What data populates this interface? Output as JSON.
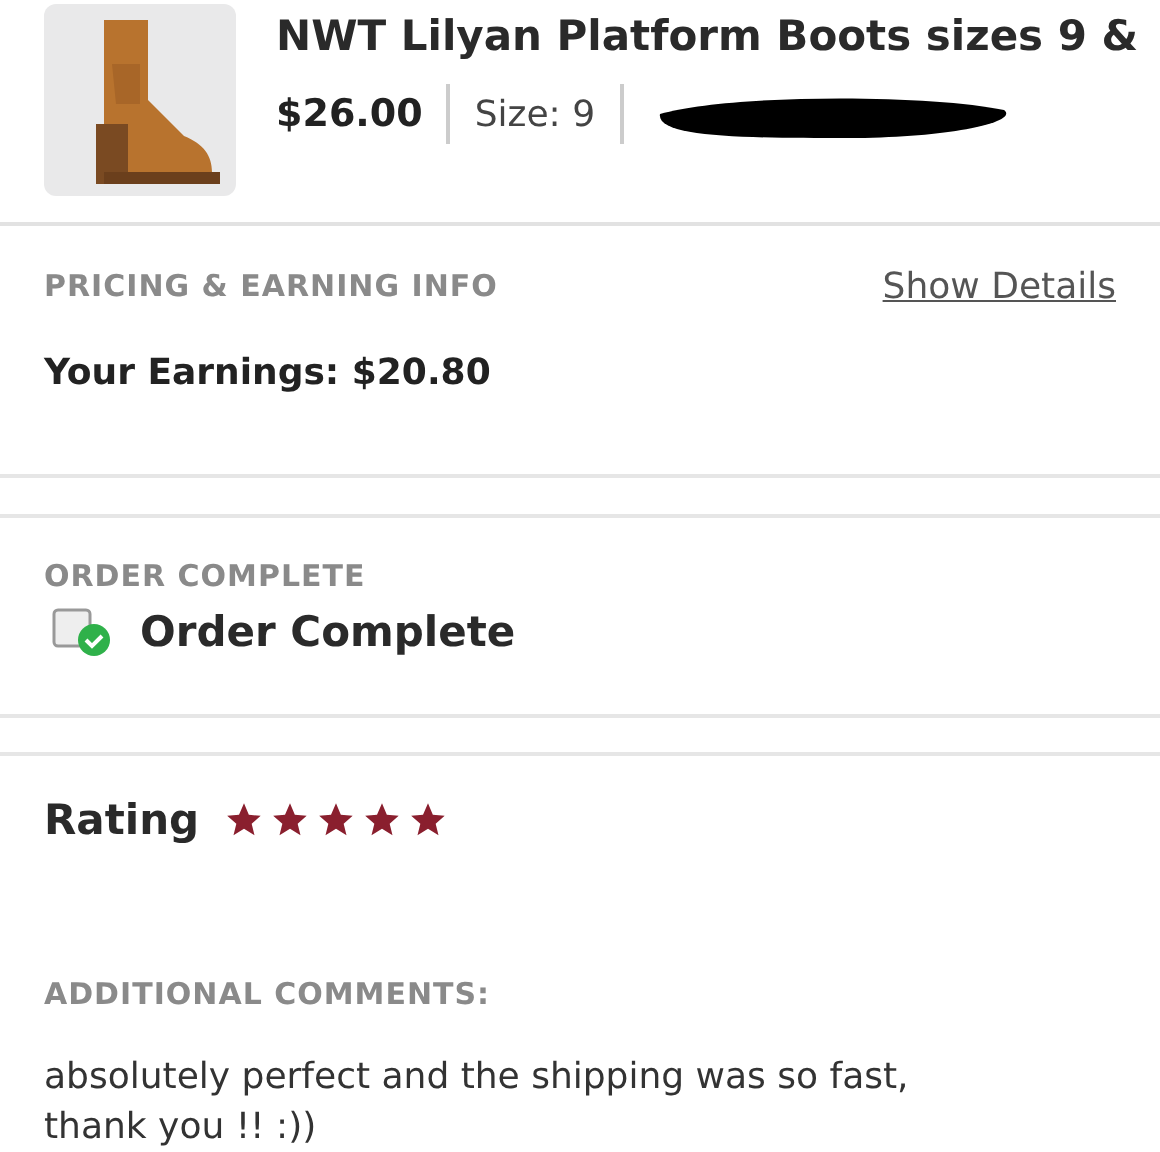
{
  "listing": {
    "title": "NWT Lilyan Platform Boots sizes 9 &",
    "price": "$26.00",
    "size": "Size: 9",
    "seller_redacted": true
  },
  "pricing": {
    "heading": "PRICING & EARNING INFO",
    "link": "Show Details",
    "earnings": "Your Earnings: $20.80"
  },
  "order": {
    "heading": "ORDER COMPLETE",
    "status": "Order Complete"
  },
  "rating": {
    "label": "Rating",
    "stars": 5
  },
  "comments": {
    "heading": "ADDITIONAL COMMENTS:",
    "text": "absolutely perfect and the shipping was so fast, thank you !! :))"
  }
}
